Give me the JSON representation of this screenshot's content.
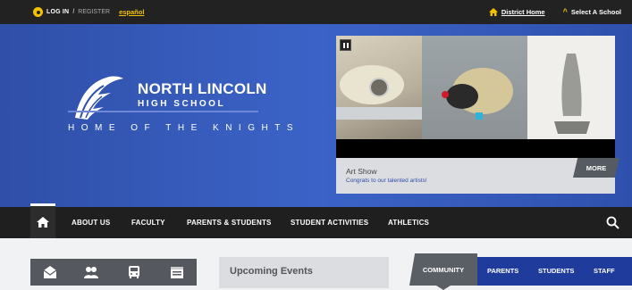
{
  "topbar": {
    "login": "LOG IN",
    "slash": "/",
    "register": "REGISTER",
    "language": "español",
    "district_home": "District Home",
    "select_school": "Select A School"
  },
  "hero": {
    "school_name": "NORTH LINCOLN",
    "school_sub": "HIGH SCHOOL",
    "tagline": "HOME OF THE KNIGHTS"
  },
  "slideshow": {
    "caption_title": "Art Show",
    "caption_sub": "Congrats to our talented artists!",
    "more_label": "MORE"
  },
  "nav": {
    "items": [
      "ABOUT US",
      "FACULTY",
      "PARENTS & STUDENTS",
      "STUDENT ACTIVITIES",
      "ATHLETICS"
    ]
  },
  "events": {
    "title": "Upcoming Events"
  },
  "tabs": {
    "community": "COMMUNITY",
    "parents": "PARENTS",
    "students": "STUDENTS",
    "staff": "STAFF"
  },
  "colors": {
    "hero_blue": "#3b63c7",
    "accent_yellow": "#f2c200",
    "nav_dark": "#1f1f1f",
    "tab_blue": "#1f3c9c"
  }
}
